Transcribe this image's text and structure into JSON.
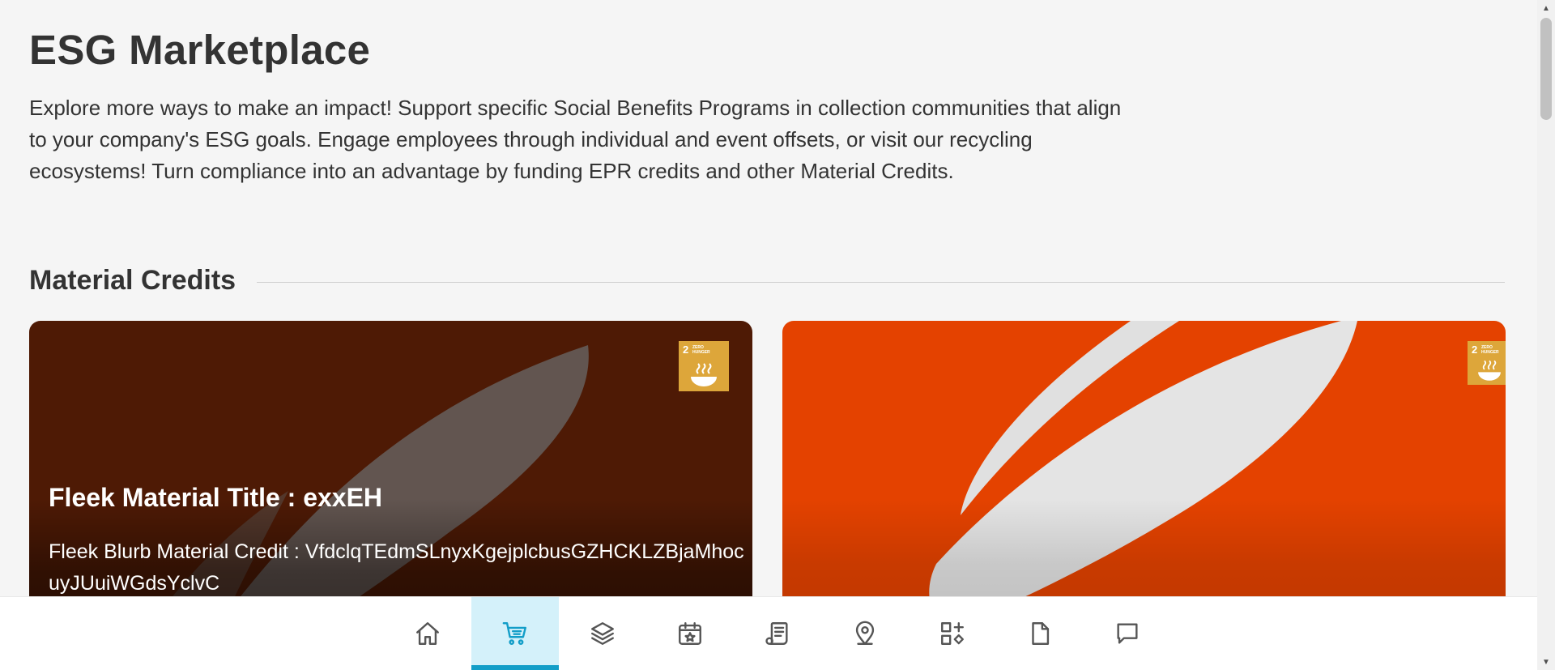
{
  "page": {
    "title": "ESG Marketplace",
    "intro": "Explore more ways to make an impact! Support specific Social Benefits Programs in collection communities that align to your company's ESG goals. Engage employees through individual and event offsets, or visit our recycling ecosystems! Turn compliance into an advantage by funding EPR credits and other Material Credits."
  },
  "section": {
    "title": "Material Credits"
  },
  "cards": [
    {
      "title": "Fleek Material Title : exxEH",
      "blurb": "Fleek Blurb Material Credit : VfdclqTEdmSLnyxKgejplcbusGZHCKLZBjaMhocuyJUuiWGdsYclvC",
      "badge_number": "2",
      "badge_label": "ZERO HUNGER",
      "background": "#4e1a05"
    },
    {
      "title": "",
      "blurb": "",
      "badge_number": "2",
      "badge_label": "ZERO HUNGER",
      "background": "#e44200"
    }
  ],
  "bottom_nav": {
    "active_index": 1,
    "active_color": "#139ec8",
    "items": [
      {
        "icon": "home-icon"
      },
      {
        "icon": "cart-icon"
      },
      {
        "icon": "layers-icon"
      },
      {
        "icon": "calendar-star-icon"
      },
      {
        "icon": "receipt-icon"
      },
      {
        "icon": "location-pin-icon"
      },
      {
        "icon": "shapes-icon"
      },
      {
        "icon": "document-icon"
      },
      {
        "icon": "chat-icon"
      }
    ]
  },
  "colors": {
    "badge": "#dda63a",
    "background": "#f5f5f5"
  }
}
